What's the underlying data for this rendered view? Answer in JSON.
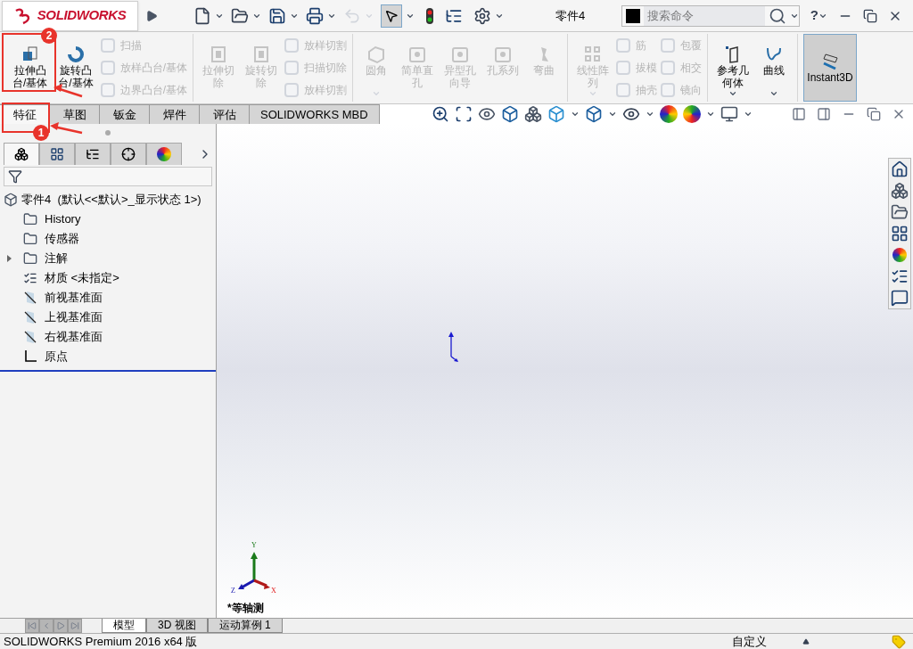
{
  "app": {
    "logo": "SOLIDWORKS",
    "title": "零件4",
    "search": {
      "placeholder": "搜索命令"
    },
    "help": "?"
  },
  "ribbon": {
    "groups": [
      {
        "columns": [
          {
            "kind": "large",
            "items": [
              {
                "lines": [
                  "拉伸凸",
                  "台/基体"
                ],
                "disabled": false,
                "dropdown": false
              },
              {
                "lines": [
                  "旋转凸",
                  "台/基体"
                ],
                "disabled": false,
                "dropdown": false
              }
            ]
          },
          {
            "kind": "small",
            "items": [
              {
                "label": "扫描",
                "disabled": true
              },
              {
                "label": "放样凸台/基体",
                "disabled": true
              },
              {
                "label": "边界凸台/基体",
                "disabled": true
              }
            ]
          }
        ]
      },
      {
        "columns": [
          {
            "kind": "large",
            "items": [
              {
                "lines": [
                  "拉伸切",
                  "除"
                ],
                "disabled": true,
                "dropdown": false
              },
              {
                "lines": [
                  "旋转切",
                  "除"
                ],
                "disabled": true,
                "dropdown": false
              }
            ]
          },
          {
            "kind": "small",
            "items": [
              {
                "label": "放样切割",
                "disabled": true
              },
              {
                "label": "扫描切除",
                "disabled": true
              },
              {
                "label": "放样切割",
                "disabled": true
              }
            ]
          }
        ]
      },
      {
        "columns": [
          {
            "kind": "large",
            "items": [
              {
                "lines": [
                  "圆角"
                ],
                "disabled": true,
                "dropdown": true
              },
              {
                "lines": [
                  "简单直",
                  "孔"
                ],
                "disabled": true,
                "dropdown": false
              },
              {
                "lines": [
                  "异型孔",
                  "向导"
                ],
                "disabled": true,
                "dropdown": false
              },
              {
                "lines": [
                  "孔系列"
                ],
                "disabled": true,
                "dropdown": false
              },
              {
                "lines": [
                  "弯曲"
                ],
                "disabled": true,
                "dropdown": false
              }
            ]
          }
        ]
      },
      {
        "columns": [
          {
            "kind": "large",
            "items": [
              {
                "lines": [
                  "线性阵",
                  "列"
                ],
                "disabled": true,
                "dropdown": true
              }
            ]
          },
          {
            "kind": "small",
            "items": [
              {
                "label": "筋",
                "disabled": true
              },
              {
                "label": "拔模",
                "disabled": true
              },
              {
                "label": "抽壳",
                "disabled": true
              }
            ]
          },
          {
            "kind": "small",
            "items": [
              {
                "label": "包覆",
                "disabled": true
              },
              {
                "label": "相交",
                "disabled": true
              },
              {
                "label": "镜向",
                "disabled": true
              }
            ]
          }
        ]
      },
      {
        "columns": [
          {
            "kind": "large",
            "items": [
              {
                "lines": [
                  "参考几",
                  "何体"
                ],
                "disabled": false,
                "dropdown": true
              },
              {
                "lines": [
                  "曲线"
                ],
                "disabled": false,
                "dropdown": true
              }
            ]
          }
        ]
      },
      {
        "columns": [
          {
            "kind": "toggle",
            "items": [
              {
                "lines": [
                  "Instant3D"
                ],
                "disabled": false,
                "dropdown": false,
                "selected": true
              }
            ]
          }
        ]
      }
    ]
  },
  "command_tabs": [
    {
      "label": "特征",
      "selected": true
    },
    {
      "label": "草图",
      "selected": false
    },
    {
      "label": "钣金",
      "selected": false
    },
    {
      "label": "焊件",
      "selected": false
    },
    {
      "label": "评估",
      "selected": false
    },
    {
      "label": "SOLIDWORKS MBD",
      "selected": false
    }
  ],
  "panel_tabs": [
    {
      "selected": true
    },
    {
      "selected": false
    },
    {
      "selected": false
    },
    {
      "selected": false
    },
    {
      "selected": false
    }
  ],
  "tree": {
    "root": {
      "label": "零件4  (默认<<默认>_显示状态 1>)"
    },
    "children": [
      {
        "kind": "folder",
        "label": "History"
      },
      {
        "kind": "folder",
        "label": "传感器"
      },
      {
        "kind": "folder",
        "label": "注解",
        "expanded": false
      },
      {
        "kind": "material",
        "label": "材质 <未指定>"
      },
      {
        "kind": "plane",
        "label": "前视基准面"
      },
      {
        "kind": "plane",
        "label": "上视基准面"
      },
      {
        "kind": "plane",
        "label": "右视基准面"
      },
      {
        "kind": "origin",
        "label": "原点"
      }
    ]
  },
  "viewport": {
    "triad": {
      "x": "X",
      "y": "Y",
      "z": "Z"
    },
    "view_name": "*等轴测"
  },
  "bottom_tabs": [
    {
      "label": "模型",
      "selected": true
    },
    {
      "label": "3D 视图",
      "selected": false
    },
    {
      "label": "运动算例 1",
      "selected": false
    }
  ],
  "status_bar": {
    "text": "SOLIDWORKS Premium 2016 x64 版",
    "units": "自定义"
  },
  "annotations": [
    {
      "number": "2"
    },
    {
      "number": "1"
    }
  ]
}
